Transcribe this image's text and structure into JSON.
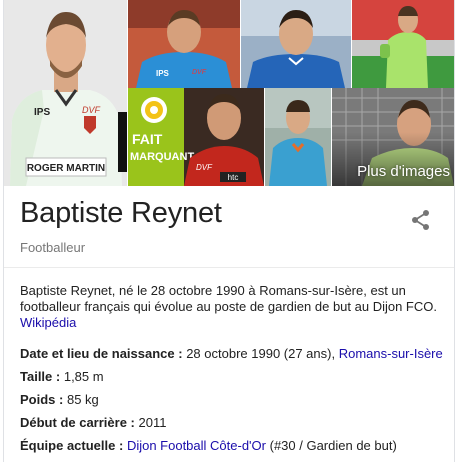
{
  "gallery": {
    "photos": [
      {
        "name": "photo-main"
      },
      {
        "name": "photo-2"
      },
      {
        "name": "photo-3"
      },
      {
        "name": "photo-4"
      },
      {
        "name": "photo-5"
      },
      {
        "name": "photo-6"
      },
      {
        "name": "photo-7"
      }
    ],
    "badge_line1": "FAIT",
    "badge_line2": "MARQUANT",
    "jersey_sponsor": "ROGER MARTIN",
    "jersey_brand": "DVF",
    "jersey_left": "IPS",
    "jersey_small_brand": "htc",
    "more_label": "Plus d'images"
  },
  "entity": {
    "name": "Baptiste Reynet",
    "type": "Footballeur"
  },
  "description": {
    "text": "Baptiste Reynet, né le 28 octobre 1990 à Romans-sur-Isère, est un footballeur français qui évolue au poste de gardien de but au Dijon FCO.",
    "source": "Wikipédia"
  },
  "facts": {
    "birth": {
      "label": "Date et lieu de naissance :",
      "value": "28 octobre 1990 (27 ans),",
      "link": "Romans-sur-Isère"
    },
    "height": {
      "label": "Taille :",
      "value": "1,85 m"
    },
    "weight": {
      "label": "Poids :",
      "value": "85 kg"
    },
    "debut": {
      "label": "Début de carrière :",
      "value": "2011"
    },
    "team": {
      "label": "Équipe actuelle :",
      "link": "Dijon Football Côte-d'Or",
      "value": "(#30 / Gardien de but)"
    }
  },
  "colors": {
    "link": "#1a0dab",
    "subtitle": "#777777",
    "text": "#222222",
    "icon": "#757575"
  },
  "icons": {
    "share": "share-icon"
  }
}
